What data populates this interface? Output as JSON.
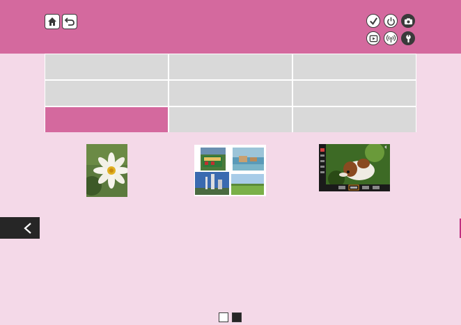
{
  "header": {
    "home_icon": "home-icon",
    "back_icon": "return-icon",
    "modes": [
      {
        "icon": "checkmark-icon",
        "active": false
      },
      {
        "icon": "power-icon",
        "active": false
      },
      {
        "icon": "camera-icon",
        "active": true
      },
      {
        "icon": "playback-icon",
        "active": false
      },
      {
        "icon": "wireless-icon",
        "active": false
      },
      {
        "icon": "wrench-icon",
        "active": false
      }
    ]
  },
  "grid": {
    "rows": 3,
    "columns": 3,
    "selected_row": 3,
    "selected_column": 1
  },
  "thumbnails": [
    {
      "name": "flower-photo"
    },
    {
      "name": "collage-photo"
    },
    {
      "name": "dog-camera-screen"
    }
  ],
  "colors": {
    "accent": "#d4699e",
    "background": "#f4d9e8",
    "cell": "#d9d9d9"
  },
  "pagination": {
    "current": 1,
    "total": 2
  }
}
